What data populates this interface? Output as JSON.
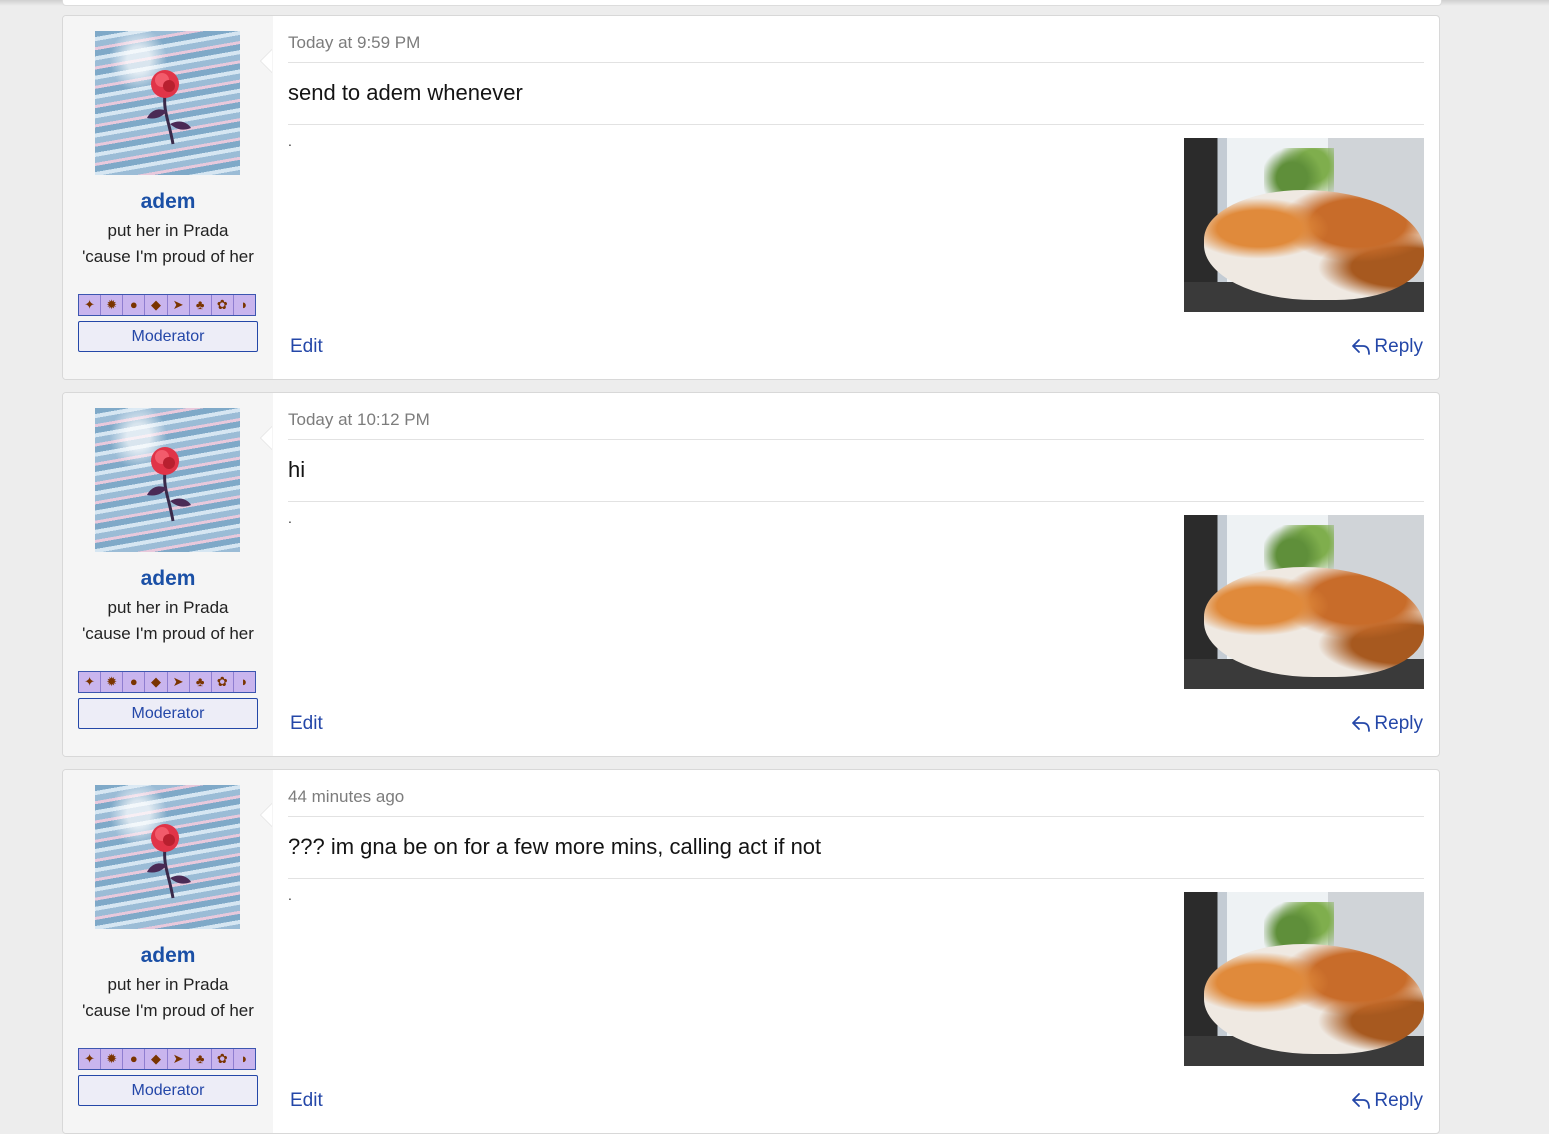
{
  "posts": [
    {
      "username": "adem",
      "user_title": "put her in Prada 'cause I'm proud of her",
      "role": "Moderator",
      "timestamp": "Today at 9:59 PM",
      "message": "send to adem whenever",
      "signature": ".",
      "edit_label": "Edit",
      "reply_label": "Reply"
    },
    {
      "username": "adem",
      "user_title": "put her in Prada 'cause I'm proud of her",
      "role": "Moderator",
      "timestamp": "Today at 10:12 PM",
      "message": "hi",
      "signature": ".",
      "edit_label": "Edit",
      "reply_label": "Reply"
    },
    {
      "username": "adem",
      "user_title": "put her in Prada 'cause I'm proud of her",
      "role": "Moderator",
      "timestamp": "44 minutes ago",
      "message": "??? im gna be on for a few more mins, calling act if not",
      "signature": ".",
      "edit_label": "Edit",
      "reply_label": "Reply"
    }
  ],
  "icons": {
    "avatar": "rose-on-water-avatar",
    "badges": [
      "dragon-badge",
      "flame-badge",
      "fist-badge",
      "diamond-badge",
      "arrow-badge",
      "leaf-badge",
      "gear-badge",
      "wave-badge"
    ],
    "reply": "reply-arrow-icon"
  },
  "colors": {
    "link": "#2447a8",
    "username": "#1b50a6",
    "badge_bg": "#c9b5ee"
  }
}
